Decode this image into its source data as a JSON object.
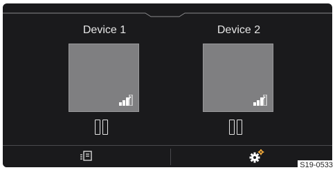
{
  "devices": [
    {
      "name": "Device 1",
      "state": "paused"
    },
    {
      "name": "Device 2",
      "state": "paused"
    }
  ],
  "bottom_bar": {
    "left_icon": "list-menu-icon",
    "right_icon": "settings-gear-icon"
  },
  "reference_code": "S19-0533",
  "colors": {
    "background": "#1a1a1c",
    "tile": "#7f7f81",
    "text": "#e6e6e6"
  }
}
